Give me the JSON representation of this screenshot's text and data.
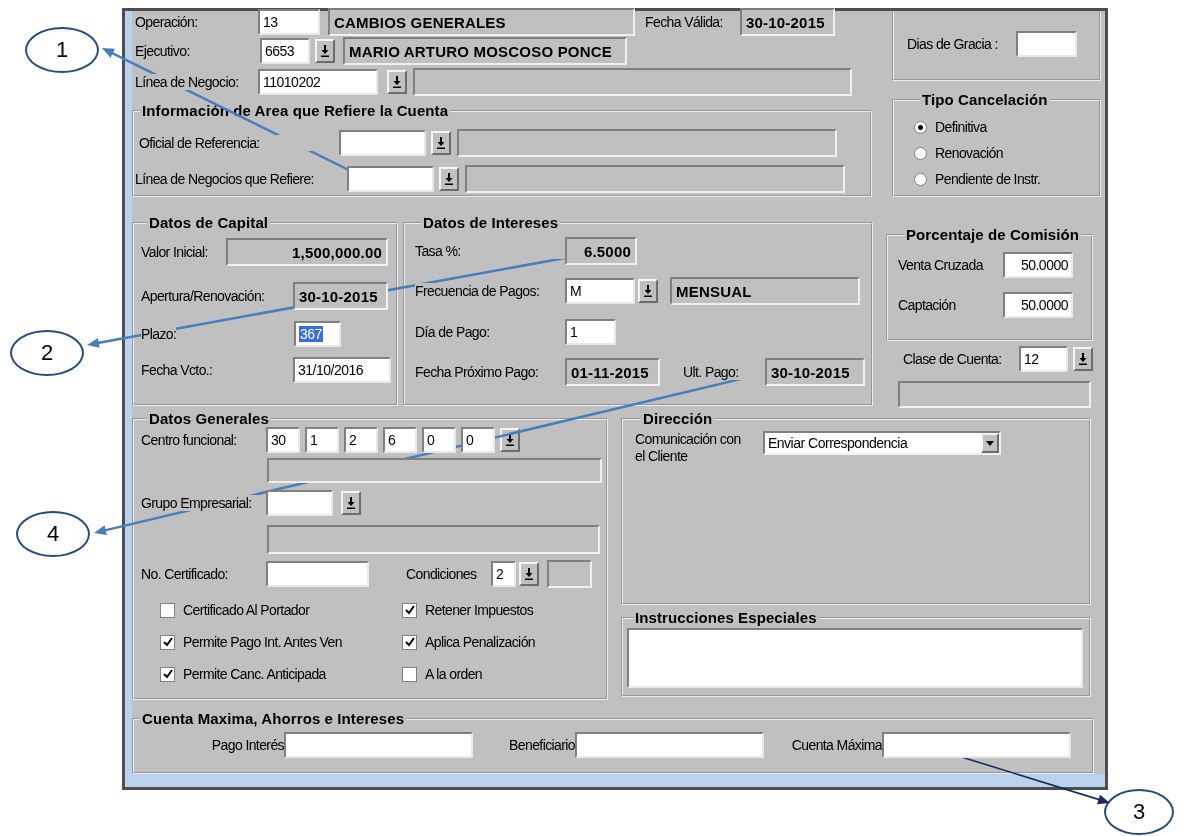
{
  "top": {
    "operacion": {
      "label": "Operación:",
      "code": "13",
      "description": "CAMBIOS GENERALES"
    },
    "fecha_valida": {
      "label": "Fecha Válida:",
      "value": "30-10-2015"
    },
    "ejecutivo": {
      "label": "Ejecutivo:",
      "code": "6653",
      "description": "MARIO ARTURO MOSCOSO PONCE"
    },
    "linea_negocio": {
      "label": "Línea de Negocio:",
      "code": "11010202"
    }
  },
  "referencia": {
    "title": "Información de Area que Refiere la Cuenta",
    "rows": [
      {
        "label": "Oficial de Referencia:"
      },
      {
        "label": "Línea de Negocios que Refiere:"
      }
    ]
  },
  "gracia": {
    "label": "Dias de Gracia :"
  },
  "tipo_cancelacion": {
    "title": "Tipo Cancelación",
    "options": [
      {
        "label": "Definitiva",
        "selected": true
      },
      {
        "label": "Renovación",
        "selected": false
      },
      {
        "label": "Pendiente de Instr.",
        "selected": false
      }
    ]
  },
  "capital": {
    "title": "Datos de Capital",
    "valor_inicial": {
      "label": "Valor Inicial:",
      "value": "1,500,000.00"
    },
    "apertura": {
      "label": "Apertura/Renovación:",
      "value": "30-10-2015"
    },
    "plazo": {
      "label": "Plazo:",
      "value": "367",
      "selected": true
    },
    "vencimiento": {
      "label": "Fecha Vcto.:",
      "value": "31/10/2016"
    }
  },
  "intereses": {
    "title": "Datos de Intereses",
    "tasa": {
      "label": "Tasa %:",
      "value": "6.5000"
    },
    "frecuencia": {
      "label": "Frecuencia de Pagos:",
      "code": "M",
      "description": "MENSUAL"
    },
    "dia_pago": {
      "label": "Día de Pago:",
      "value": "1"
    },
    "proximo_pago": {
      "label": "Fecha Próximo Pago:",
      "value": "01-11-2015"
    },
    "ultimo_pago": {
      "label": "Ult. Pago:",
      "value": "30-10-2015"
    }
  },
  "comision": {
    "title": "Porcentaje de Comisión",
    "rows": [
      {
        "label": "Venta Cruzada",
        "value": "50.0000"
      },
      {
        "label": "Captación",
        "value": "50.0000"
      }
    ]
  },
  "clase_cuenta": {
    "label": "Clase de Cuenta:",
    "value": "12"
  },
  "generales": {
    "title": "Datos Generales",
    "centro": {
      "label": "Centro funcional:",
      "values": [
        "30",
        "1",
        "2",
        "6",
        "0",
        "0"
      ]
    },
    "grupo": {
      "label": "Grupo Empresarial:"
    },
    "certificado": {
      "label": "No. Certificado:"
    },
    "condiciones": {
      "label": "Condiciones",
      "value": "2"
    },
    "checks": [
      {
        "label": "Certificado Al Portador",
        "checked": false
      },
      {
        "label": "Permite Pago Int. Antes Ven",
        "checked": true
      },
      {
        "label": "Permite Canc. Anticipada",
        "checked": true
      },
      {
        "label": "Retener Impuestos",
        "checked": true
      },
      {
        "label": "Aplica Penalización",
        "checked": true
      },
      {
        "label": "A la orden",
        "checked": false
      }
    ]
  },
  "direccion": {
    "title": "Dirección",
    "label": "Comunicación con el Cliente",
    "value": "Enviar Correspondencia"
  },
  "instrucciones": {
    "title": "Instrucciones Especiales"
  },
  "cuenta_maxima": {
    "title": "Cuenta Maxima, Ahorros e Intereses",
    "fields": [
      {
        "label": "Pago Interés"
      },
      {
        "label": "Beneficiario"
      },
      {
        "label": "Cuenta Máxima"
      }
    ]
  },
  "callouts": [
    {
      "number": "1"
    },
    {
      "number": "2"
    },
    {
      "number": "3"
    },
    {
      "number": "4"
    }
  ]
}
